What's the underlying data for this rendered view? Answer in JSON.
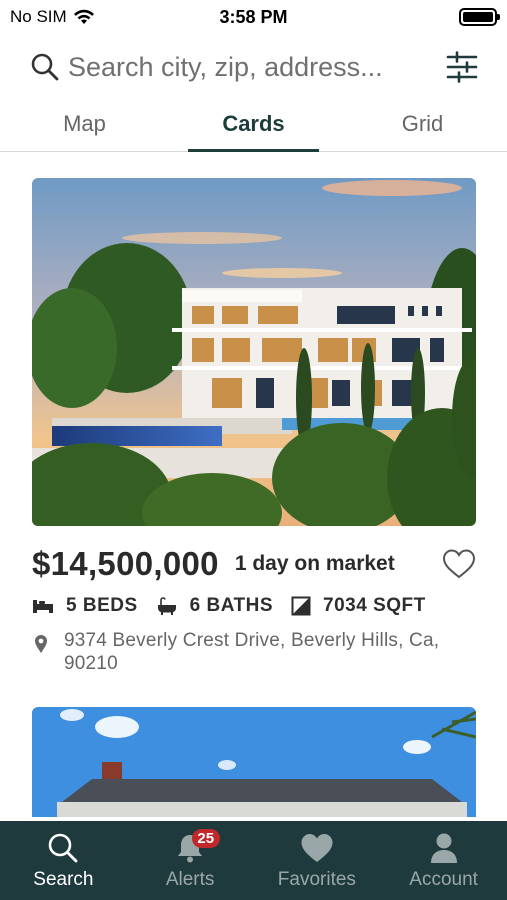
{
  "status_bar": {
    "carrier": "No SIM",
    "time": "3:58 PM"
  },
  "search": {
    "placeholder": "Search city, zip, address..."
  },
  "tabs": [
    {
      "label": "Map",
      "active": false
    },
    {
      "label": "Cards",
      "active": true
    },
    {
      "label": "Grid",
      "active": false
    }
  ],
  "listings": [
    {
      "price": "$14,500,000",
      "days_on_market": "1 day on market",
      "beds": "5 BEDS",
      "baths": "6 BATHS",
      "sqft": "7034 SQFT",
      "address": "9374 Beverly Crest Drive, Beverly Hills, Ca, 90210",
      "favorited": false
    }
  ],
  "bottom_nav": {
    "items": [
      {
        "label": "Search",
        "icon": "search-icon",
        "active": true
      },
      {
        "label": "Alerts",
        "icon": "bell-icon",
        "active": false,
        "badge": "25"
      },
      {
        "label": "Favorites",
        "icon": "heart-icon",
        "active": false
      },
      {
        "label": "Account",
        "icon": "person-icon",
        "active": false
      }
    ]
  },
  "colors": {
    "accent": "#1f3a3d",
    "badge": "#c0282b",
    "inactive_nav": "#9aa7a8"
  }
}
